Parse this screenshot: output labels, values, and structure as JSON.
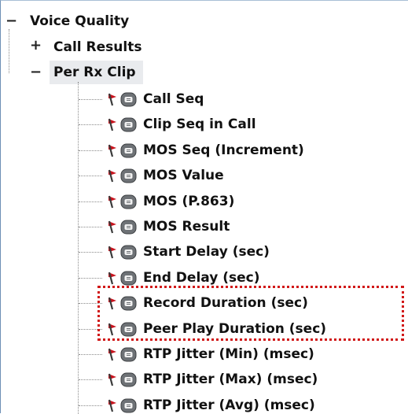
{
  "tree": {
    "root": {
      "label": "Voice Quality",
      "expander": "−"
    },
    "call_results": {
      "label": "Call Results",
      "expander": "+"
    },
    "per_rx_clip": {
      "label": "Per Rx Clip",
      "expander": "−",
      "children": [
        "Call Seq",
        "Clip Seq in Call",
        "MOS Seq (Increment)",
        "MOS Value",
        "MOS (P.863)",
        "MOS Result",
        "Start Delay (sec)",
        "End Delay (sec)",
        "Record Duration (sec)",
        "Peer Play Duration (sec)",
        "RTP Jitter (Min) (msec)",
        "RTP Jitter (Max) (msec)",
        "RTP Jitter (Avg) (msec)"
      ]
    }
  },
  "icons": {
    "flag": "red-flag-icon",
    "item": "gray-pill-icon"
  },
  "colors": {
    "highlight": "#d11818",
    "flag": "#c8141e",
    "pill": "#6e7276",
    "selected_bg": "#e9ebee"
  }
}
